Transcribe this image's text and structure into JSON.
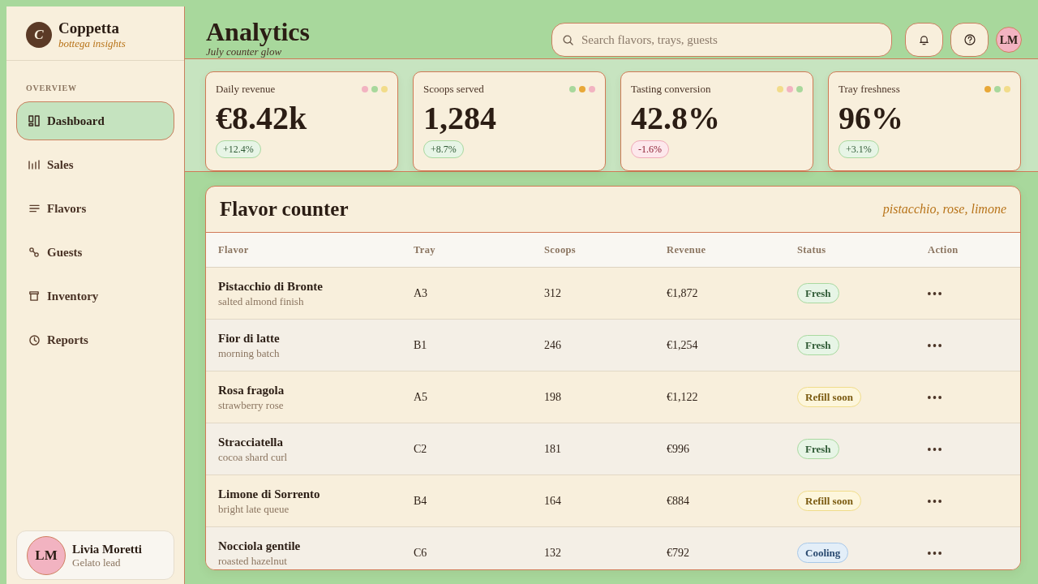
{
  "sidebar": {
    "brand": {
      "logo_letter": "C",
      "name": "Coppetta",
      "tagline": "bottega insights"
    },
    "section_label": "OVERVIEW",
    "nav": [
      {
        "label": "Dashboard",
        "selected": true
      },
      {
        "label": "Sales",
        "selected": false
      },
      {
        "label": "Flavors",
        "selected": false
      },
      {
        "label": "Guests",
        "selected": false
      },
      {
        "label": "Inventory",
        "selected": false
      },
      {
        "label": "Reports",
        "selected": false
      }
    ],
    "user": {
      "initials": "LM",
      "name": "Livia Moretti",
      "role": "Gelato lead"
    }
  },
  "header": {
    "title": "Analytics",
    "subtitle": "July counter glow",
    "search": {
      "placeholder": "Search flavors, trays, guests"
    },
    "avatar_initials": "LM"
  },
  "stats": [
    {
      "label": "Daily revenue",
      "value": "€8.42k",
      "change": "+12.4%",
      "negative": false,
      "dots": [
        {
          "color": "#f2b3c1"
        },
        {
          "color": "#a8d89c"
        },
        {
          "color": "#f2dc8a"
        }
      ]
    },
    {
      "label": "Scoops served",
      "value": "1,284",
      "change": "+8.7%",
      "negative": false,
      "dots": [
        {
          "color": "#a8d89c"
        },
        {
          "color": "#e8a838"
        },
        {
          "color": "#f2b3c1"
        }
      ]
    },
    {
      "label": "Tasting conversion",
      "value": "42.8%",
      "change": "-1.6%",
      "negative": true,
      "dots": [
        {
          "color": "#f2dc8a"
        },
        {
          "color": "#f2b3c1"
        },
        {
          "color": "#a8d89c"
        }
      ]
    },
    {
      "label": "Tray freshness",
      "value": "96%",
      "change": "+3.1%",
      "negative": false,
      "dots": [
        {
          "color": "#e8a838"
        },
        {
          "color": "#a8d89c"
        },
        {
          "color": "#f2dc8a"
        }
      ]
    }
  ],
  "table": {
    "title": "Flavor counter",
    "note": "pistacchio, rose, limone",
    "columns": [
      "Flavor",
      "Tray",
      "Scoops",
      "Revenue",
      "Status",
      "Action"
    ],
    "rows": [
      {
        "flavor": "Pistacchio di Bronte",
        "detail": "salted almond finish",
        "tray": "A3",
        "scoops": "312",
        "revenue": "€1,872",
        "status": {
          "label": "Fresh",
          "kind": "fresh"
        }
      },
      {
        "flavor": "Fior di latte",
        "detail": "morning batch",
        "tray": "B1",
        "scoops": "246",
        "revenue": "€1,254",
        "status": {
          "label": "Fresh",
          "kind": "fresh"
        }
      },
      {
        "flavor": "Rosa fragola",
        "detail": "strawberry rose",
        "tray": "A5",
        "scoops": "198",
        "revenue": "€1,122",
        "status": {
          "label": "Refill soon",
          "kind": "refill"
        }
      },
      {
        "flavor": "Stracciatella",
        "detail": "cocoa shard curl",
        "tray": "C2",
        "scoops": "181",
        "revenue": "€996",
        "status": {
          "label": "Fresh",
          "kind": "fresh"
        }
      },
      {
        "flavor": "Limone di Sorrento",
        "detail": "bright late queue",
        "tray": "B4",
        "scoops": "164",
        "revenue": "€884",
        "status": {
          "label": "Refill soon",
          "kind": "refill"
        }
      },
      {
        "flavor": "Nocciola gentile",
        "detail": "roasted hazelnut",
        "tray": "C6",
        "scoops": "132",
        "revenue": "€792",
        "status": {
          "label": "Cooling",
          "kind": "cooling"
        }
      }
    ]
  }
}
